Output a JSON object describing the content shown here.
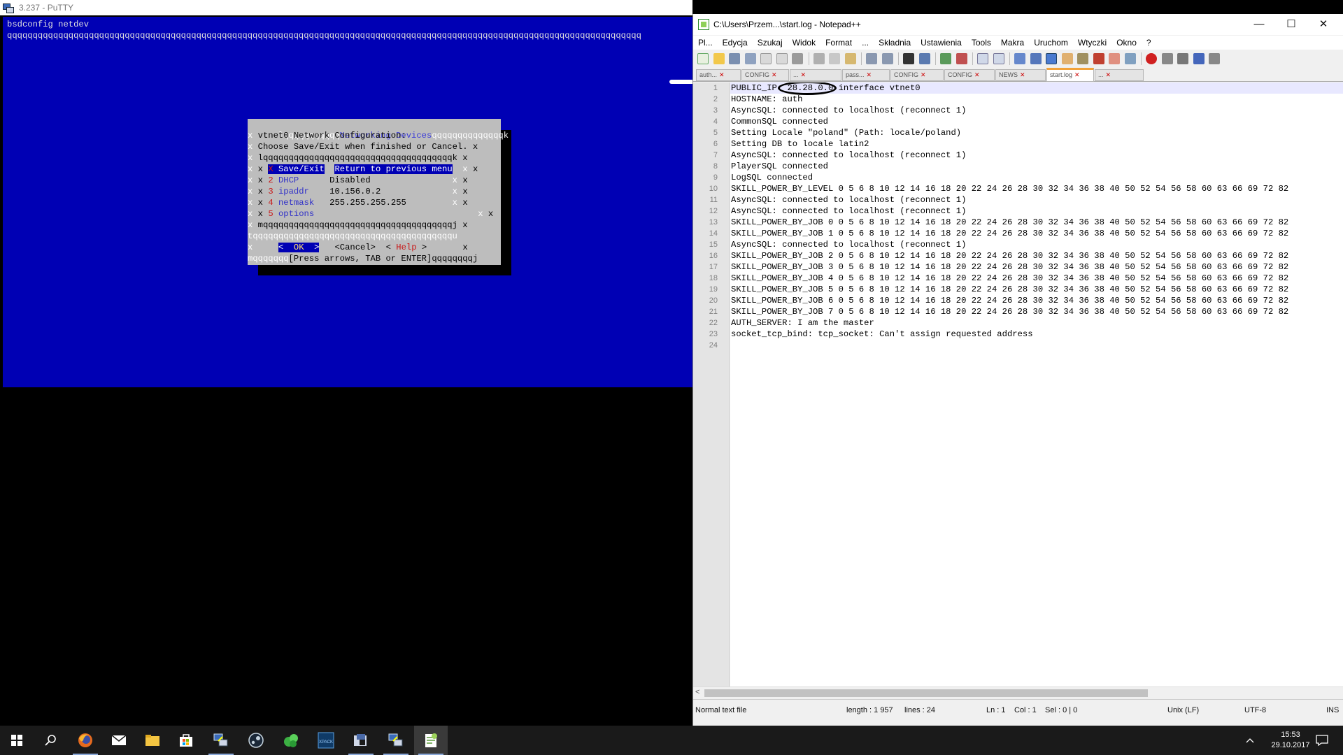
{
  "putty": {
    "title": "3.237 - PuTTY",
    "command_line": "bsdconfig netdev",
    "hline": "qqqqqqqqqqqqqqqqqqqqqqqqqqqqqqqqqqqqqqqqqqqqqqqqqqqqqqqqqqqqqqqqqqqqqqqqqqqqqqqqqqqqqqqqqqqqqqqqqqqqqqqqqqqqqqqqqqqqqqqqqqqq",
    "dialog": {
      "title": "Networking Devices",
      "top_left": "lqqqqqqqqqqq",
      "top_right": "qqqqqqqqqqqqqqk",
      "subtitle_1": "vtnet0 Network Configuration:",
      "subtitle_2": "Choose Save/Exit when finished or Cancel.",
      "inner_top": "lqqqqqqqqqqqqqqqqqqqqqqqqqqqqqqqqqqqqqk",
      "menu": [
        {
          "key": "X",
          "label": "Save/Exit",
          "value": "Return to previous menu"
        },
        {
          "key": "2",
          "label": "DHCP",
          "value": "Disabled"
        },
        {
          "key": "3",
          "label": "ipaddr",
          "value": "10.156.0.2"
        },
        {
          "key": "4",
          "label": "netmask",
          "value": "255.255.255.255"
        },
        {
          "key": "5",
          "label": "options",
          "value": ""
        }
      ],
      "inner_bottom": "mqqqqqqqqqqqqqqqqqqqqqqqqqqqqqqqqqqqqqj",
      "separator": "tqqqqqqqqqqqqqqqqqqqqqqqqqqqqqqqqqqqqqqqu",
      "buttons": {
        "ok_open": "<",
        "ok": "OK",
        "ok_close": ">",
        "cancel": "<Cancel>",
        "help_open": "<",
        "help": "Help",
        "help_close": ">"
      },
      "bottom_left": "mqqqqqqq",
      "hint": "[Press arrows, TAB or ENTER]",
      "bottom_right": "qqqqqqqqj",
      "border_char": "x"
    }
  },
  "npp": {
    "title": "C:\\Users\\Przem...\\start.log - Notepad++",
    "menu": [
      "Pl...",
      "Edycja",
      "Szukaj",
      "Widok",
      "Format",
      "...",
      "Składnia",
      "Ustawienia",
      "Tools",
      "Makra",
      "Uruchom",
      "Wtyczki",
      "Okno",
      "?"
    ],
    "tabs": [
      "auth...",
      "CONFIG",
      "...",
      "pass...",
      "CONFIG",
      "CONFIG",
      "NEWS",
      "start.log",
      "..."
    ],
    "active_tab": "start.log",
    "lines": [
      "PUBLIC_IP: 28.28.0.0 interface vtnet0",
      "HOSTNAME: auth",
      "AsyncSQL: connected to localhost (reconnect 1)",
      "CommonSQL connected",
      "Setting Locale \"poland\" (Path: locale/poland)",
      "Setting DB to locale latin2",
      "AsyncSQL: connected to localhost (reconnect 1)",
      "PlayerSQL connected",
      "LogSQL connected",
      "SKILL_POWER_BY_LEVEL 0 5 6 8 10 12 14 16 18 20 22 24 26 28 30 32 34 36 38 40 50 52 54 56 58 60 63 66 69 72 82",
      "AsyncSQL: connected to localhost (reconnect 1)",
      "AsyncSQL: connected to localhost (reconnect 1)",
      "SKILL_POWER_BY_JOB 0 0 5 6 8 10 12 14 16 18 20 22 24 26 28 30 32 34 36 38 40 50 52 54 56 58 60 63 66 69 72 82",
      "SKILL_POWER_BY_JOB 1 0 5 6 8 10 12 14 16 18 20 22 24 26 28 30 32 34 36 38 40 50 52 54 56 58 60 63 66 69 72 82",
      "AsyncSQL: connected to localhost (reconnect 1)",
      "SKILL_POWER_BY_JOB 2 0 5 6 8 10 12 14 16 18 20 22 24 26 28 30 32 34 36 38 40 50 52 54 56 58 60 63 66 69 72 82",
      "SKILL_POWER_BY_JOB 3 0 5 6 8 10 12 14 16 18 20 22 24 26 28 30 32 34 36 38 40 50 52 54 56 58 60 63 66 69 72 82",
      "SKILL_POWER_BY_JOB 4 0 5 6 8 10 12 14 16 18 20 22 24 26 28 30 32 34 36 38 40 50 52 54 56 58 60 63 66 69 72 82",
      "SKILL_POWER_BY_JOB 5 0 5 6 8 10 12 14 16 18 20 22 24 26 28 30 32 34 36 38 40 50 52 54 56 58 60 63 66 69 72 82",
      "SKILL_POWER_BY_JOB 6 0 5 6 8 10 12 14 16 18 20 22 24 26 28 30 32 34 36 38 40 50 52 54 56 58 60 63 66 69 72 82",
      "SKILL_POWER_BY_JOB 7 0 5 6 8 10 12 14 16 18 20 22 24 26 28 30 32 34 36 38 40 50 52 54 56 58 60 63 66 69 72 82",
      "AUTH_SERVER: I am the master",
      "socket_tcp_bind: tcp_socket: Can't assign requested address",
      ""
    ],
    "status": {
      "filetype": "Normal text file",
      "length": "length : 1 957",
      "lines": "lines : 24",
      "ln": "Ln : 1",
      "col": "Col : 1",
      "sel": "Sel : 0 | 0",
      "eol": "Unix (LF)",
      "encoding": "UTF-8",
      "mode": "INS"
    }
  },
  "taskbar": {
    "time": "15:53",
    "date": "29.10.2017",
    "apps": [
      "start-icon",
      "search-icon",
      "firefox-icon",
      "mail-icon",
      "file-explorer-icon",
      "store-icon",
      "putty-icon",
      "steam-icon",
      "game-icon",
      "xpack-icon",
      "tool-icon",
      "putty-icon-2",
      "notepadpp-icon"
    ]
  },
  "colors": {
    "terminal_bg": "#0000b4",
    "dialog_bg": "#bdbdbd",
    "taskbar": "#1a1a1a"
  }
}
